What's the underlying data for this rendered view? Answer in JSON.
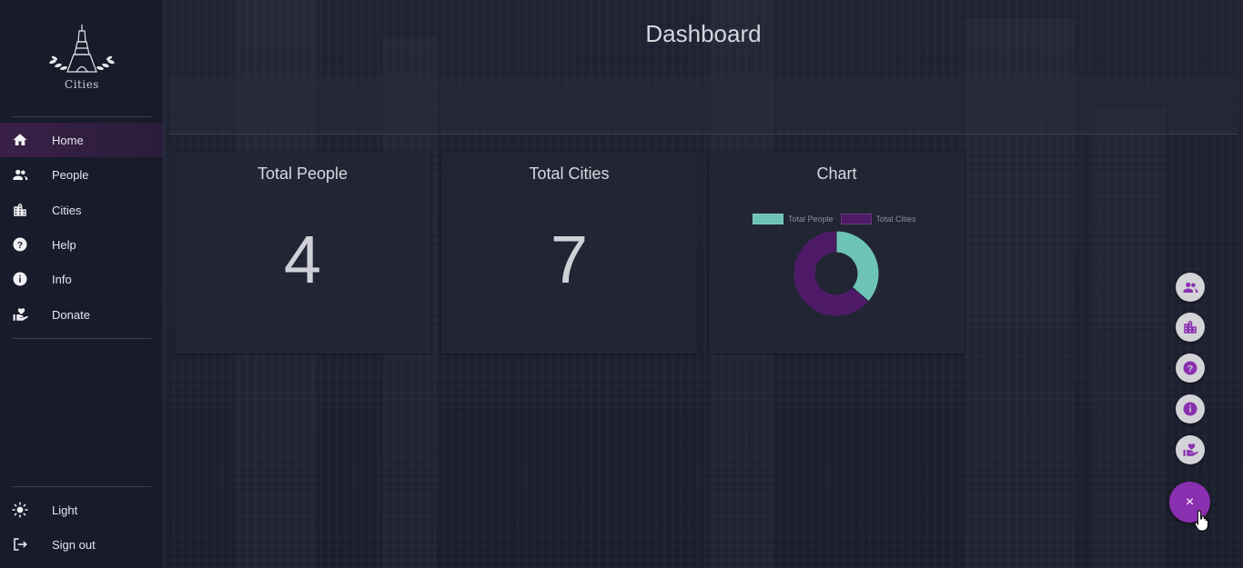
{
  "sidebar": {
    "logo_text": "Cities",
    "items": [
      {
        "label": "Home",
        "icon": "home-icon",
        "active": true
      },
      {
        "label": "People",
        "icon": "people-icon"
      },
      {
        "label": "Cities",
        "icon": "building-icon"
      },
      {
        "label": "Help",
        "icon": "help-icon"
      },
      {
        "label": "Info",
        "icon": "info-icon"
      },
      {
        "label": "Donate",
        "icon": "donate-icon"
      }
    ],
    "bottom_items": [
      {
        "label": "Light",
        "icon": "sun-icon"
      },
      {
        "label": "Sign out",
        "icon": "sign-out-icon"
      }
    ]
  },
  "main": {
    "title": "Dashboard",
    "cards": [
      {
        "title": "Total People",
        "value": "4"
      },
      {
        "title": "Total Cities",
        "value": "7"
      },
      {
        "title": "Chart"
      }
    ]
  },
  "chart_data": {
    "type": "pie",
    "labels": [
      "Total People",
      "Total Cities"
    ],
    "values": [
      4,
      7
    ],
    "colors": [
      "#6ec3b7",
      "#4e1a68"
    ],
    "legend": "top"
  },
  "fab": {
    "actions": [
      {
        "icon": "people-icon"
      },
      {
        "icon": "building-icon"
      },
      {
        "icon": "help-icon"
      },
      {
        "icon": "info-icon"
      },
      {
        "icon": "donate-icon"
      }
    ],
    "main_icon": "close-icon",
    "main_symbol": "×"
  },
  "colors": {
    "accent": "#8a2fb0",
    "sidebar_bg": "#171b2a",
    "page_bg": "#1d2130",
    "active_item_bg": "#3a2047"
  }
}
